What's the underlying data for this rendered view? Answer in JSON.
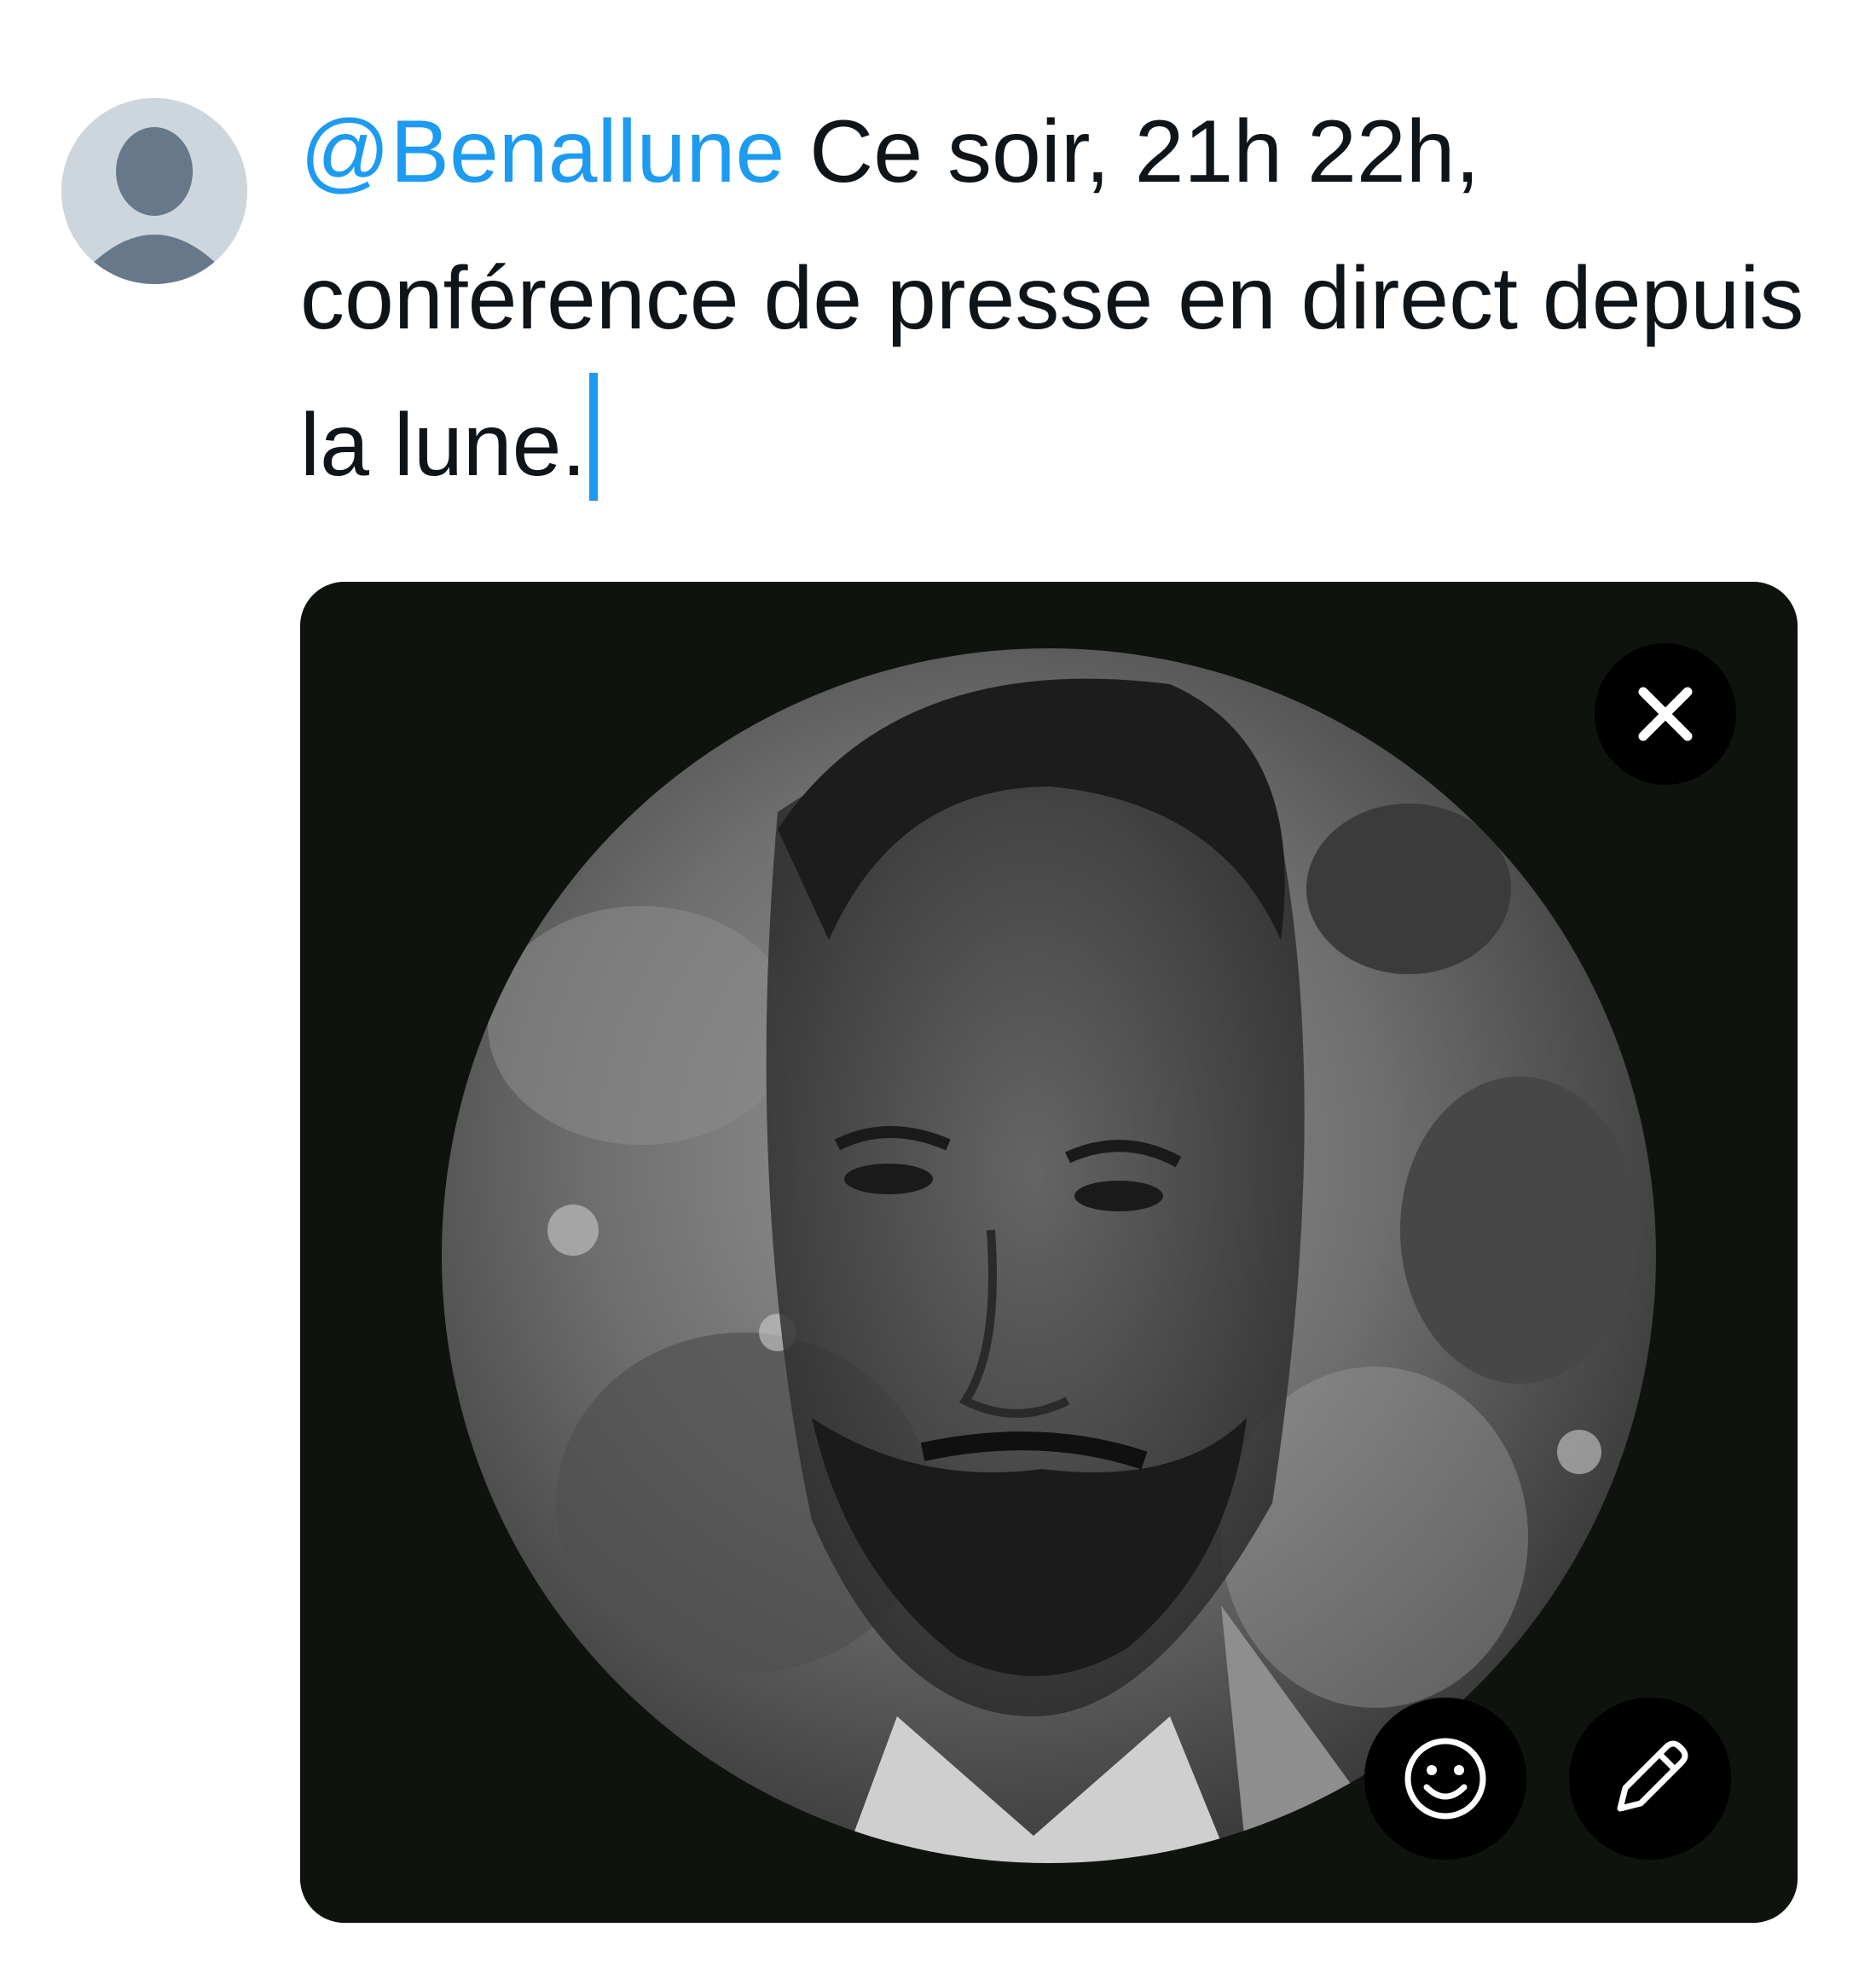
{
  "composer": {
    "mention": "@Benallune",
    "text": " Ce soir, 21h 22h, conférence de presse en direct depuis la lune."
  },
  "avatar": {
    "icon": "default-user-icon",
    "background": "#cdd6dd",
    "figure_color": "#66788a"
  },
  "media": {
    "description_icon": "moon-face-photo",
    "background": "#0e130e",
    "buttons": {
      "remove_icon": "close-icon",
      "sticker_icon": "smiley-icon",
      "edit_icon": "pencil-icon"
    }
  },
  "colors": {
    "accent": "#1d9bf0",
    "text": "#0f1419"
  }
}
